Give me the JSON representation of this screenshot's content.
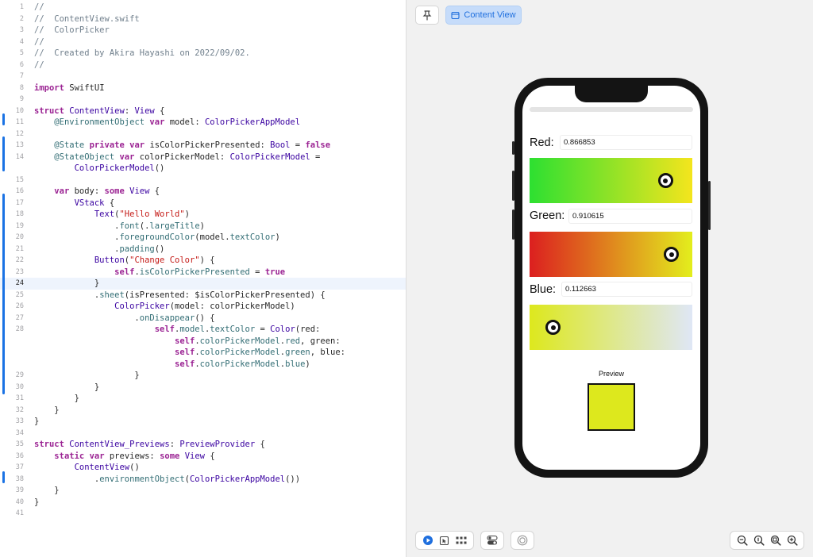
{
  "editor": {
    "current_line": 24,
    "lines": [
      {
        "num": "1",
        "tokens": [
          [
            "c",
            "//"
          ]
        ]
      },
      {
        "num": "2",
        "tokens": [
          [
            "c",
            "//  ContentView.swift"
          ]
        ]
      },
      {
        "num": "3",
        "tokens": [
          [
            "c",
            "//  ColorPicker"
          ]
        ]
      },
      {
        "num": "4",
        "tokens": [
          [
            "c",
            "//"
          ]
        ]
      },
      {
        "num": "5",
        "tokens": [
          [
            "c",
            "//  Created by Akira Hayashi on 2022/09/02."
          ]
        ]
      },
      {
        "num": "6",
        "tokens": [
          [
            "c",
            "//"
          ]
        ]
      },
      {
        "num": "7",
        "tokens": []
      },
      {
        "num": "8",
        "tokens": [
          [
            "k",
            "import"
          ],
          [
            "p",
            " SwiftUI"
          ]
        ]
      },
      {
        "num": "9",
        "tokens": []
      },
      {
        "num": "10",
        "tokens": [
          [
            "k",
            "struct"
          ],
          [
            "p",
            " "
          ],
          [
            "t",
            "ContentView"
          ],
          [
            "p",
            ": "
          ],
          [
            "t",
            "View"
          ],
          [
            "p",
            " {"
          ]
        ]
      },
      {
        "num": "11",
        "tokens": [
          [
            "p",
            "    "
          ],
          [
            "v",
            "@EnvironmentObject"
          ],
          [
            "p",
            " "
          ],
          [
            "k",
            "var"
          ],
          [
            "p",
            " model: "
          ],
          [
            "t",
            "ColorPickerAppModel"
          ]
        ]
      },
      {
        "num": "12",
        "tokens": []
      },
      {
        "num": "13",
        "tokens": [
          [
            "p",
            "    "
          ],
          [
            "v",
            "@State"
          ],
          [
            "p",
            " "
          ],
          [
            "k",
            "private"
          ],
          [
            "p",
            " "
          ],
          [
            "k",
            "var"
          ],
          [
            "p",
            " isColorPickerPresented: "
          ],
          [
            "t",
            "Bool"
          ],
          [
            "p",
            " = "
          ],
          [
            "k",
            "false"
          ]
        ]
      },
      {
        "num": "14",
        "tokens": [
          [
            "p",
            "    "
          ],
          [
            "v",
            "@StateObject"
          ],
          [
            "p",
            " "
          ],
          [
            "k",
            "var"
          ],
          [
            "p",
            " colorPickerModel: "
          ],
          [
            "t",
            "ColorPickerModel"
          ],
          [
            "p",
            " ="
          ]
        ]
      },
      {
        "num": "",
        "tokens": [
          [
            "p",
            "        "
          ],
          [
            "t",
            "ColorPickerModel"
          ],
          [
            "p",
            "()"
          ]
        ]
      },
      {
        "num": "15",
        "tokens": []
      },
      {
        "num": "16",
        "tokens": [
          [
            "p",
            "    "
          ],
          [
            "k",
            "var"
          ],
          [
            "p",
            " body: "
          ],
          [
            "k",
            "some"
          ],
          [
            "p",
            " "
          ],
          [
            "t",
            "View"
          ],
          [
            "p",
            " {"
          ]
        ]
      },
      {
        "num": "17",
        "tokens": [
          [
            "p",
            "        "
          ],
          [
            "t",
            "VStack"
          ],
          [
            "p",
            " {"
          ]
        ]
      },
      {
        "num": "18",
        "tokens": [
          [
            "p",
            "            "
          ],
          [
            "t",
            "Text"
          ],
          [
            "p",
            "("
          ],
          [
            "s",
            "\"Hello World\""
          ],
          [
            "p",
            ")"
          ]
        ]
      },
      {
        "num": "19",
        "tokens": [
          [
            "p",
            "                ."
          ],
          [
            "v",
            "font"
          ],
          [
            "p",
            "(."
          ],
          [
            "v",
            "largeTitle"
          ],
          [
            "p",
            ")"
          ]
        ]
      },
      {
        "num": "20",
        "tokens": [
          [
            "p",
            "                ."
          ],
          [
            "v",
            "foregroundColor"
          ],
          [
            "p",
            "(model."
          ],
          [
            "v",
            "textColor"
          ],
          [
            "p",
            ")"
          ]
        ]
      },
      {
        "num": "21",
        "tokens": [
          [
            "p",
            "                ."
          ],
          [
            "v",
            "padding"
          ],
          [
            "p",
            "()"
          ]
        ]
      },
      {
        "num": "22",
        "tokens": [
          [
            "p",
            "            "
          ],
          [
            "t",
            "Button"
          ],
          [
            "p",
            "("
          ],
          [
            "s",
            "\"Change Color\""
          ],
          [
            "p",
            ") {"
          ]
        ]
      },
      {
        "num": "23",
        "tokens": [
          [
            "p",
            "                "
          ],
          [
            "k",
            "self"
          ],
          [
            "p",
            "."
          ],
          [
            "v",
            "isColorPickerPresented"
          ],
          [
            "p",
            " = "
          ],
          [
            "k",
            "true"
          ]
        ]
      },
      {
        "num": "24",
        "tokens": [
          [
            "p",
            "            }"
          ]
        ]
      },
      {
        "num": "25",
        "tokens": [
          [
            "p",
            "            ."
          ],
          [
            "v",
            "sheet"
          ],
          [
            "p",
            "(isPresented: $isColorPickerPresented) {"
          ]
        ]
      },
      {
        "num": "26",
        "tokens": [
          [
            "p",
            "                "
          ],
          [
            "t",
            "ColorPicker"
          ],
          [
            "p",
            "(model: colorPickerModel)"
          ]
        ]
      },
      {
        "num": "27",
        "tokens": [
          [
            "p",
            "                    ."
          ],
          [
            "v",
            "onDisappear"
          ],
          [
            "p",
            "() {"
          ]
        ]
      },
      {
        "num": "28",
        "tokens": [
          [
            "p",
            "                        "
          ],
          [
            "k",
            "self"
          ],
          [
            "p",
            "."
          ],
          [
            "v",
            "model"
          ],
          [
            "p",
            "."
          ],
          [
            "v",
            "textColor"
          ],
          [
            "p",
            " = "
          ],
          [
            "t",
            "Color"
          ],
          [
            "p",
            "(red:"
          ]
        ]
      },
      {
        "num": "",
        "tokens": [
          [
            "p",
            "                            "
          ],
          [
            "k",
            "self"
          ],
          [
            "p",
            "."
          ],
          [
            "v",
            "colorPickerModel"
          ],
          [
            "p",
            "."
          ],
          [
            "v",
            "red"
          ],
          [
            "p",
            ", green:"
          ]
        ]
      },
      {
        "num": "",
        "tokens": [
          [
            "p",
            "                            "
          ],
          [
            "k",
            "self"
          ],
          [
            "p",
            "."
          ],
          [
            "v",
            "colorPickerModel"
          ],
          [
            "p",
            "."
          ],
          [
            "v",
            "green"
          ],
          [
            "p",
            ", blue:"
          ]
        ]
      },
      {
        "num": "",
        "tokens": [
          [
            "p",
            "                            "
          ],
          [
            "k",
            "self"
          ],
          [
            "p",
            "."
          ],
          [
            "v",
            "colorPickerModel"
          ],
          [
            "p",
            "."
          ],
          [
            "v",
            "blue"
          ],
          [
            "p",
            ")"
          ]
        ]
      },
      {
        "num": "29",
        "tokens": [
          [
            "p",
            "                    }"
          ]
        ]
      },
      {
        "num": "30",
        "tokens": [
          [
            "p",
            "            }"
          ]
        ]
      },
      {
        "num": "31",
        "tokens": [
          [
            "p",
            "        }"
          ]
        ]
      },
      {
        "num": "32",
        "tokens": [
          [
            "p",
            "    }"
          ]
        ]
      },
      {
        "num": "33",
        "tokens": [
          [
            "p",
            "}"
          ]
        ]
      },
      {
        "num": "34",
        "tokens": []
      },
      {
        "num": "35",
        "tokens": [
          [
            "k",
            "struct"
          ],
          [
            "p",
            " "
          ],
          [
            "t",
            "ContentView_Previews"
          ],
          [
            "p",
            ": "
          ],
          [
            "t",
            "PreviewProvider"
          ],
          [
            "p",
            " {"
          ]
        ]
      },
      {
        "num": "36",
        "tokens": [
          [
            "p",
            "    "
          ],
          [
            "k",
            "static"
          ],
          [
            "p",
            " "
          ],
          [
            "k",
            "var"
          ],
          [
            "p",
            " previews: "
          ],
          [
            "k",
            "some"
          ],
          [
            "p",
            " "
          ],
          [
            "t",
            "View"
          ],
          [
            "p",
            " {"
          ]
        ]
      },
      {
        "num": "37",
        "tokens": [
          [
            "p",
            "        "
          ],
          [
            "t",
            "ContentView"
          ],
          [
            "p",
            "()"
          ]
        ]
      },
      {
        "num": "38",
        "tokens": [
          [
            "p",
            "            ."
          ],
          [
            "v",
            "environmentObject"
          ],
          [
            "p",
            "("
          ],
          [
            "t",
            "ColorPickerAppModel"
          ],
          [
            "p",
            "())"
          ]
        ]
      },
      {
        "num": "39",
        "tokens": [
          [
            "p",
            "    }"
          ]
        ]
      },
      {
        "num": "40",
        "tokens": [
          [
            "p",
            "}"
          ]
        ]
      },
      {
        "num": "41",
        "tokens": []
      }
    ]
  },
  "canvas": {
    "pin_icon": "pin-icon",
    "content_view_icon": "preview-window-icon",
    "content_view_label": "Content View"
  },
  "preview": {
    "red_label": "Red:",
    "red_value": "0.866853",
    "green_label": "Green:",
    "green_value": "0.910615",
    "blue_label": "Blue:",
    "blue_value": "0.112663",
    "red_knob_fraction": 0.87,
    "green_knob_fraction": 0.91,
    "blue_knob_fraction": 0.11,
    "preview_label": "Preview",
    "preview_color": "#dde81d"
  },
  "toolbar": {
    "live_icon": "play-circle-icon",
    "select_icon": "cursor-select-icon",
    "grid_icon": "grid-icon",
    "variants_icon": "toggle-variants-icon",
    "device_icon": "device-settings-icon",
    "zoom_out_icon": "zoom-out-icon",
    "zoom_fit_icon": "zoom-fit-icon",
    "zoom_100_icon": "zoom-actual-icon",
    "zoom_in_icon": "zoom-in-icon"
  },
  "colors": {
    "accent": "#1f6fde",
    "keyword": "#9b2393",
    "type": "#3900a0",
    "string": "#c41a16",
    "comment": "#707f8c"
  }
}
